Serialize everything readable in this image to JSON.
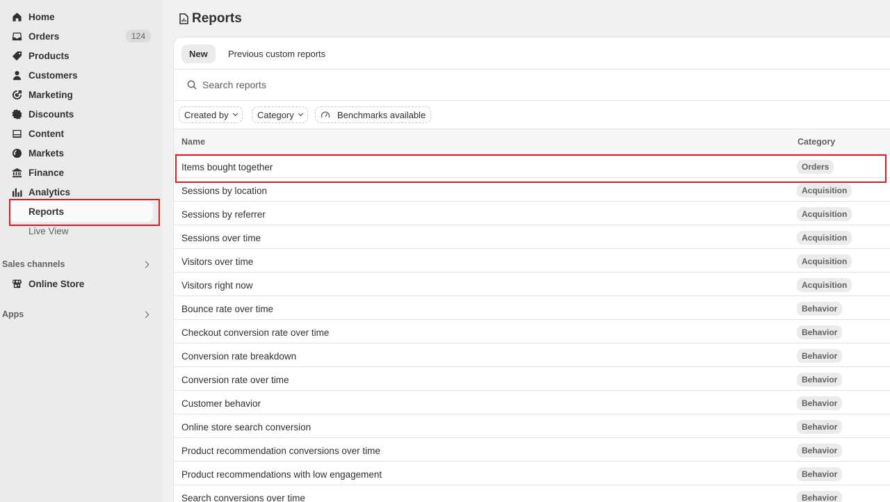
{
  "sidebar": {
    "items": [
      {
        "label": "Home",
        "icon": "home-icon"
      },
      {
        "label": "Orders",
        "icon": "inbox-icon",
        "badge": "124"
      },
      {
        "label": "Products",
        "icon": "tag-icon"
      },
      {
        "label": "Customers",
        "icon": "person-icon"
      },
      {
        "label": "Marketing",
        "icon": "target-icon"
      },
      {
        "label": "Discounts",
        "icon": "discount-icon"
      },
      {
        "label": "Content",
        "icon": "content-icon"
      },
      {
        "label": "Markets",
        "icon": "globe-icon"
      },
      {
        "label": "Finance",
        "icon": "bank-icon"
      },
      {
        "label": "Analytics",
        "icon": "bar-chart-icon"
      }
    ],
    "analytics_sub": [
      {
        "label": "Reports",
        "active": true
      },
      {
        "label": "Live View",
        "active": false
      }
    ],
    "sales_channels": {
      "label": "Sales channels",
      "items": [
        {
          "label": "Online Store",
          "icon": "store-icon"
        }
      ]
    },
    "apps": {
      "label": "Apps"
    }
  },
  "header": {
    "title": "Reports"
  },
  "tabs": [
    {
      "label": "New",
      "selected": true
    },
    {
      "label": "Previous custom reports",
      "selected": false
    }
  ],
  "search": {
    "placeholder": "Search reports"
  },
  "filters": [
    {
      "label": "Created by"
    },
    {
      "label": "Category"
    },
    {
      "label": "Benchmarks available"
    }
  ],
  "table": {
    "columns": [
      "Name",
      "Category"
    ],
    "rows": [
      {
        "name": "Items bought together",
        "category": "Orders"
      },
      {
        "name": "Sessions by location",
        "category": "Acquisition"
      },
      {
        "name": "Sessions by referrer",
        "category": "Acquisition"
      },
      {
        "name": "Sessions over time",
        "category": "Acquisition"
      },
      {
        "name": "Visitors over time",
        "category": "Acquisition"
      },
      {
        "name": "Visitors right now",
        "category": "Acquisition"
      },
      {
        "name": "Bounce rate over time",
        "category": "Behavior"
      },
      {
        "name": "Checkout conversion rate over time",
        "category": "Behavior"
      },
      {
        "name": "Conversion rate breakdown",
        "category": "Behavior"
      },
      {
        "name": "Conversion rate over time",
        "category": "Behavior"
      },
      {
        "name": "Customer behavior",
        "category": "Behavior"
      },
      {
        "name": "Online store search conversion",
        "category": "Behavior"
      },
      {
        "name": "Product recommendation conversions over time",
        "category": "Behavior"
      },
      {
        "name": "Product recommendations with low engagement",
        "category": "Behavior"
      },
      {
        "name": "Search conversions over time",
        "category": "Behavior"
      }
    ]
  },
  "colors": {
    "highlight": "#e01b24",
    "sidebar_bg": "#ebebeb",
    "text": "#303030"
  }
}
